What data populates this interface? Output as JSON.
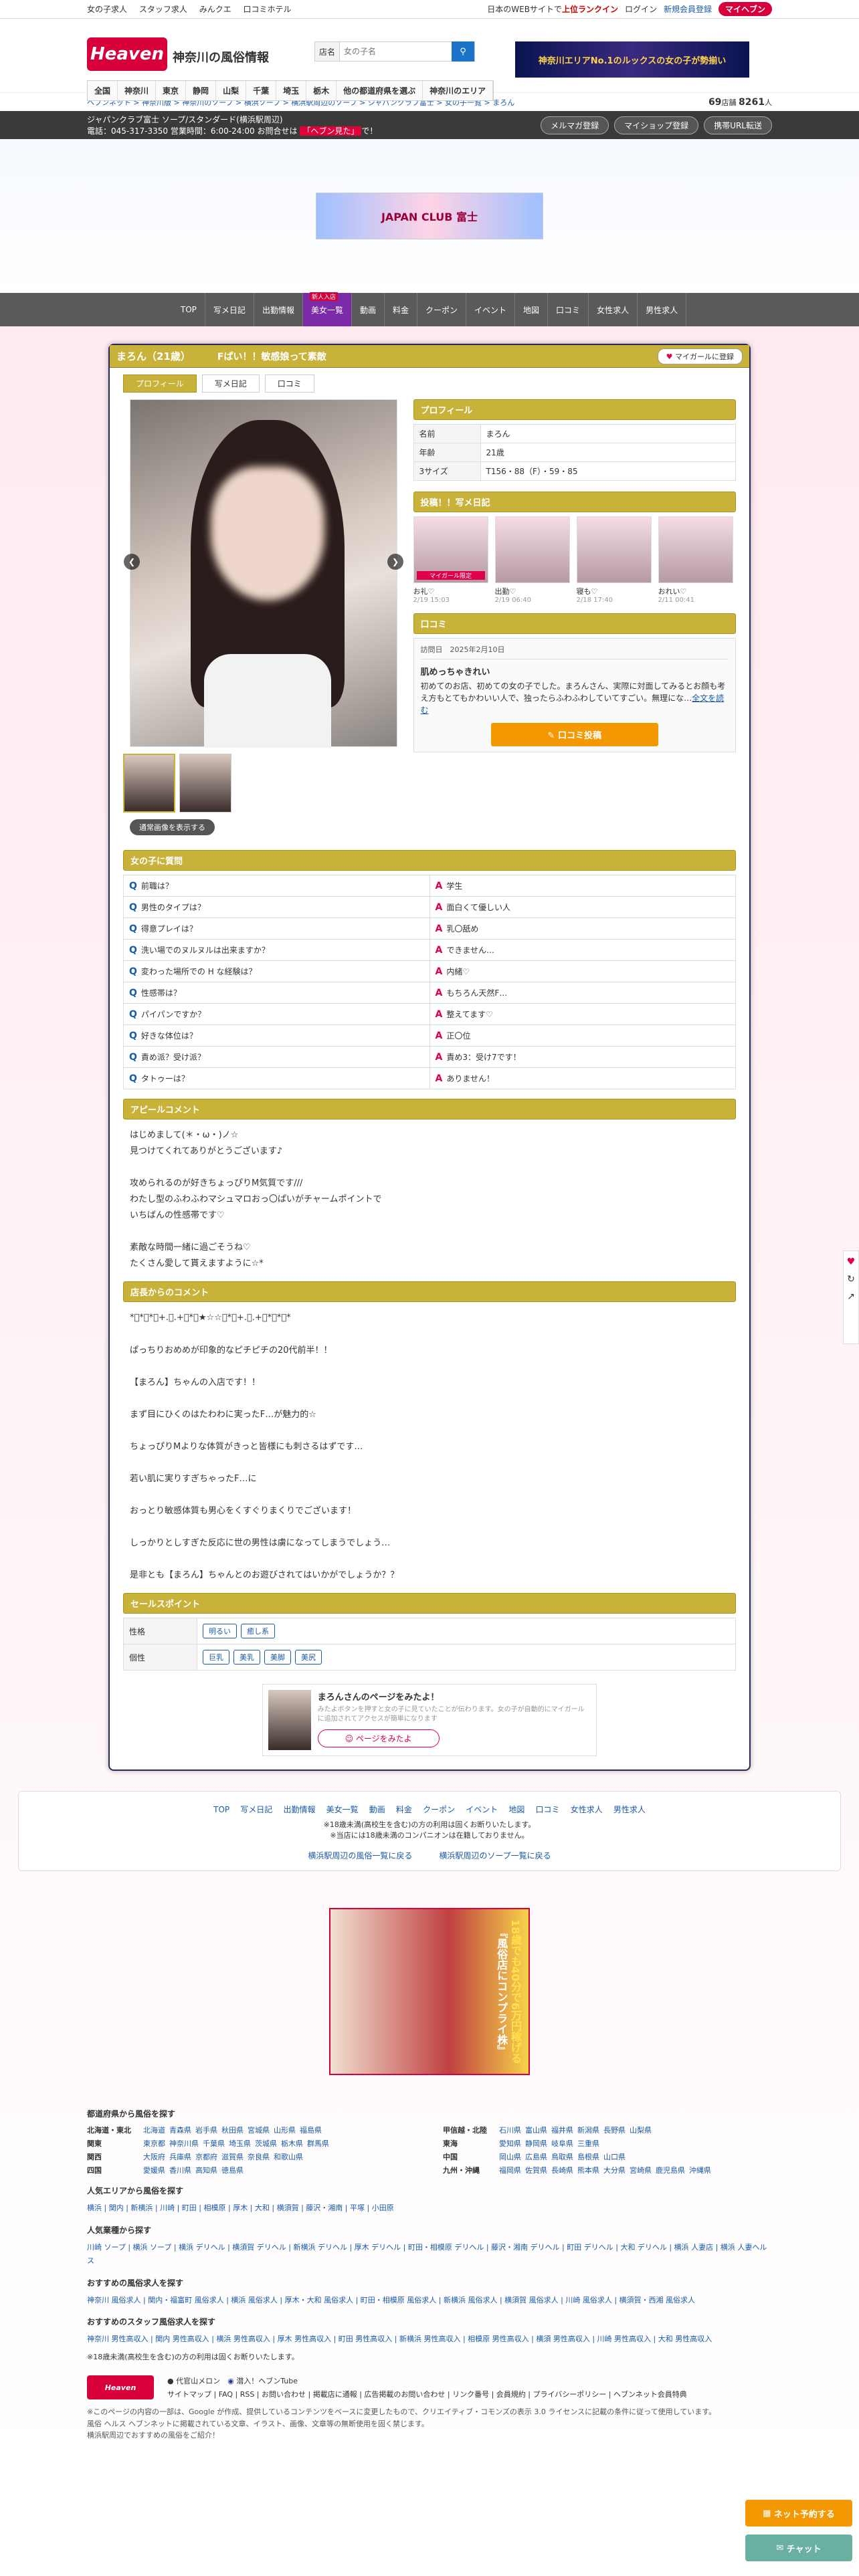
{
  "topbar": {
    "links": [
      "女の子求人",
      "スタッフ求人",
      "みんクエ",
      "口コミホテル"
    ],
    "promo_prefix": "日本のWEBサイトで",
    "promo_rank": "上位ランクイン",
    "login": "ログイン",
    "register": "新規会員登録",
    "myheaven": "マイヘブン"
  },
  "header": {
    "logo": "Heaven",
    "logo_sub": "神奈川の風俗情報",
    "search_label": "店名",
    "search_placeholder": "女の子名",
    "banner_text": "神奈川エリアNo.1のルックスの女の子が勢揃い"
  },
  "areas": [
    "全国",
    "神奈川",
    "東京",
    "静岡",
    "山梨",
    "千葉",
    "埼玉",
    "栃木",
    "他の都道府県を選ぶ",
    "神奈川のエリア"
  ],
  "breadcrumb": {
    "path": "ヘブンネット > 神奈川版 > 神奈川のソープ > 横浜ソープ > 横浜駅周辺のソープ > ジャパンクラブ富士 > 女の子一覧 > まろん",
    "count_shops": "69",
    "count_shops_unit": "店舗",
    "count_girls": "8261",
    "count_girls_unit": "人"
  },
  "shopbar": {
    "name": "ジャパンクラブ富士 ソープ/スタンダード(横浜駅周辺)",
    "tel": "電話：045-317-3350 営業時間：6:00-24:00 お問合せは",
    "open": "「ヘブン見た」",
    "open_suffix": "で！",
    "buttons": [
      "メルマガ登録",
      "マイショップ登録",
      "携帯URL転送"
    ]
  },
  "shop_banner": "JAPAN CLUB 富士",
  "shopnav": [
    "TOP",
    "写メ日記",
    "出勤情報",
    "美女一覧",
    "動画",
    "料金",
    "クーポン",
    "イベント",
    "地図",
    "口コミ",
    "女性求人",
    "男性求人"
  ],
  "girl": {
    "name": "まろん（21歳）",
    "catch": "Fぱい！！敏感娘って素敵",
    "mygirl_btn": "マイガールに登録",
    "tabs": [
      "プロフィール",
      "写メ日記",
      "口コミ"
    ],
    "switch_btn": "通常画像を表示する"
  },
  "profile": {
    "head": "プロフィール",
    "rows": [
      {
        "k": "名前",
        "v": "まろん"
      },
      {
        "k": "年齢",
        "v": "21歳"
      },
      {
        "k": "3サイズ",
        "v": "T156・88（F）・59・85"
      }
    ]
  },
  "diary": {
    "head": "投稿！！写メ日記",
    "items": [
      {
        "t": "お礼♡",
        "d": "2/19 15:03"
      },
      {
        "t": "出勤♡",
        "d": "2/19 06:40"
      },
      {
        "t": "寝も♡",
        "d": "2/18 17:40"
      },
      {
        "t": "おれい♡",
        "d": "2/11 00:41"
      }
    ]
  },
  "kuchikomi": {
    "head": "口コミ",
    "date": "訪問日　2025年2月10日",
    "title": "肌めっちゃきれい",
    "body": "初めてのお店、初めての女の子でした。まろんさん、実際に対面してみるとお顔も考え方もとてもかわいい人で、独ったらふわふわしていてすごい。無理にな…",
    "more": "全文を読む",
    "post_btn": "口コミ投稿"
  },
  "qa": {
    "head": "女の子に質問",
    "rows": [
      {
        "q": "前職は？",
        "a": "学生"
      },
      {
        "q": "男性のタイプは？",
        "a": "面白くて優しい人"
      },
      {
        "q": "得意プレイは？",
        "a": "乳〇舐め"
      },
      {
        "q": "洗い場でのヌルヌルは出来ますか？",
        "a": "できません…"
      },
      {
        "q": "変わった場所での H な経験は？",
        "a": "内緒♡"
      },
      {
        "q": "性感帯は？",
        "a": "もちろん天然F…"
      },
      {
        "q": "パイパンですか？",
        "a": "整えてます♡"
      },
      {
        "q": "好きな体位は？",
        "a": "正〇位"
      },
      {
        "q": "責め派？受け派？",
        "a": "責め3：受け7です！"
      },
      {
        "q": "タトゥーは？",
        "a": "ありません！"
      }
    ]
  },
  "appeal": {
    "head": "アピールコメント",
    "text": "はじめまして(＊・ω・)ノ☆\n見つけてくれてありがとうございます♪\n\n攻められるのが好きちょっぴりM気質です///\nわたし型のふわふわマシュマロおっ〇ぱいがチャームポイントで\nいちばんの性感帯です♡\n\n素敵な時間一緒に過ごそうね♡\nたくさん愛して貰えますように☆*"
  },
  "shop_comment": {
    "head": "店長からのコメント",
    "text": "*ﾟ*ﾟ*ﾟ+.。.+ﾟ*ﾟ★☆☆ﾟ*ﾟ+.。.+ﾟ*ﾟ*ﾟ*\n\nぱっちりおめめが印象的なピチピチの20代前半！！\n\n【まろん】ちゃんの入店です！！\n\nまず目にひくのはたわわに実ったF…が魅力的☆\n\nちょっぴりMよりな体質がきっと皆様にも刺さるはずです…\n\n若い肌に実りすぎちゃったF…に\n\nおっとり敏感体質も男心をくすぐりまくりでございます！\n\nしっかりとしすぎた反応に世の男性は虜になってしまうでしょう…\n\n是非とも【まろん】ちゃんとのお遊びされてはいかがでしょうか？？"
  },
  "sales": {
    "head": "セールスポイント",
    "rows": [
      {
        "k": "性格",
        "tags": [
          "明るい",
          "癒し系"
        ]
      },
      {
        "k": "個性",
        "tags": [
          "巨乳",
          "美乳",
          "美脚",
          "美尻"
        ]
      }
    ]
  },
  "mygirl_box": {
    "t1": "まろんさんのページをみたよ！",
    "t2": "みたよボタンを押すと女の子に見ていたことが伝わります。女の子が自動的にマイガールに追加されてアクセスが簡単になります",
    "btn": "ページをみたよ"
  },
  "footer_nav": {
    "links": [
      "TOP",
      "写メ日記",
      "出勤情報",
      "美女一覧",
      "動画",
      "料金",
      "クーポン",
      "イベント",
      "地図",
      "口コミ",
      "女性求人",
      "男性求人"
    ],
    "note1": "※18歳未満(高校生を含む)の方の利用は固くお断りいたします。",
    "note2": "※当店には18歳未満のコンパニオンは在籍しておりません。",
    "back1": "横浜駅周辺の風俗一覧に戻る",
    "back2": "横浜駅周辺のソープ一覧に戻る"
  },
  "ad": {
    "text1": "『風俗店にコンプライ株』",
    "text2": "18歳でも40分で6万円稼げる"
  },
  "site_links": {
    "pref_head": "都道府県から風俗を探す",
    "pref_rows": [
      {
        "r": "北海道・東北",
        "p": [
          "北海道",
          "青森県",
          "岩手県",
          "秋田県",
          "宮城県",
          "山形県",
          "福島県"
        ]
      },
      {
        "r": "甲信越・北陸",
        "p": [
          "石川県",
          "富山県",
          "福井県",
          "新潟県",
          "長野県",
          "山梨県"
        ]
      },
      {
        "r": "関東",
        "p": [
          "東京都",
          "神奈川県",
          "千葉県",
          "埼玉県",
          "茨城県",
          "栃木県",
          "群馬県"
        ]
      },
      {
        "r": "東海",
        "p": [
          "愛知県",
          "静岡県",
          "岐阜県",
          "三重県"
        ]
      },
      {
        "r": "関西",
        "p": [
          "大阪府",
          "兵庫県",
          "京都府",
          "滋賀県",
          "奈良県",
          "和歌山県"
        ]
      },
      {
        "r": "中国",
        "p": [
          "岡山県",
          "広島県",
          "鳥取県",
          "島根県",
          "山口県"
        ]
      },
      {
        "r": "四国",
        "p": [
          "愛媛県",
          "香川県",
          "高知県",
          "徳島県"
        ]
      },
      {
        "r": "九州・沖縄",
        "p": [
          "福岡県",
          "佐賀県",
          "長崎県",
          "熊本県",
          "大分県",
          "宮崎県",
          "鹿児島県",
          "沖縄県"
        ]
      }
    ],
    "area_head": "人気エリアから風俗を探す",
    "area_line": "横浜 | 関内 | 新横浜 | 川崎 | 町田 | 相模原 | 厚木 | 大和 | 横須賀 | 藤沢・湘南 | 平塚 | 小田原",
    "type_head": "人気業種から探す",
    "type_line": "川崎 ソープ | 横浜 ソープ | 横浜 デリヘル | 横須賀 デリヘル | 新横浜 デリヘル | 厚木 デリヘル | 町田・相模原 デリヘル | 藤沢・湘南 デリヘル | 町田 デリヘル | 大和 デリヘル | 横浜 人妻店 | 横浜 人妻ヘルス",
    "rec_head": "おすすめの風俗求人を探す",
    "rec_line": "神奈川 風俗求人 | 関内・福富町 風俗求人 | 横浜 風俗求人 | 厚木・大和 風俗求人 | 町田・相模原 風俗求人 | 新横浜 風俗求人 | 横須賀 風俗求人 | 川崎 風俗求人 | 横須賀・西湘 風俗求人",
    "staff_head": "おすすめのスタッフ風俗求人を探す",
    "staff_line": "神奈川 男性高収入 | 関内 男性高収入 | 横浜 男性高収入 | 厚木 男性高収入 | 町田 男性高収入 | 新横浜 男性高収入 | 相模原 男性高収入 | 横須 男性高収入 | 川崎 男性高収入 | 大和 男性高収入",
    "note": "※18歳未満(高校生を含む)の方の利用は固くお断りいたします。"
  },
  "footer_bottom": {
    "logo": "Heaven",
    "items": [
      "代官山メロン",
      "潜入！ヘブンTube"
    ],
    "links": "サイトマップ | FAQ | RSS | お問い合わせ | 掲載店に通報 | 広告掲載のお問い合わせ | リンク番号 | 会員規約 | プライバシーポリシー | ヘブンネット会員特典",
    "copy": "※このページの内容の一部は、Google が作成、提供しているコンテンツをベースに変更したもので、クリエイティブ・コモンズの表示 3.0 ライセンスに記載の条件に従って使用しています。\n風俗 ヘルス ヘブンネットに掲載されている文章、イラスト、画像、文章等の無断使用を固く禁じます。\n横浜駅周辺でおすすめの風俗をご紹介！"
  },
  "float": {
    "net": "ネット予約する",
    "chat": "チャット"
  }
}
